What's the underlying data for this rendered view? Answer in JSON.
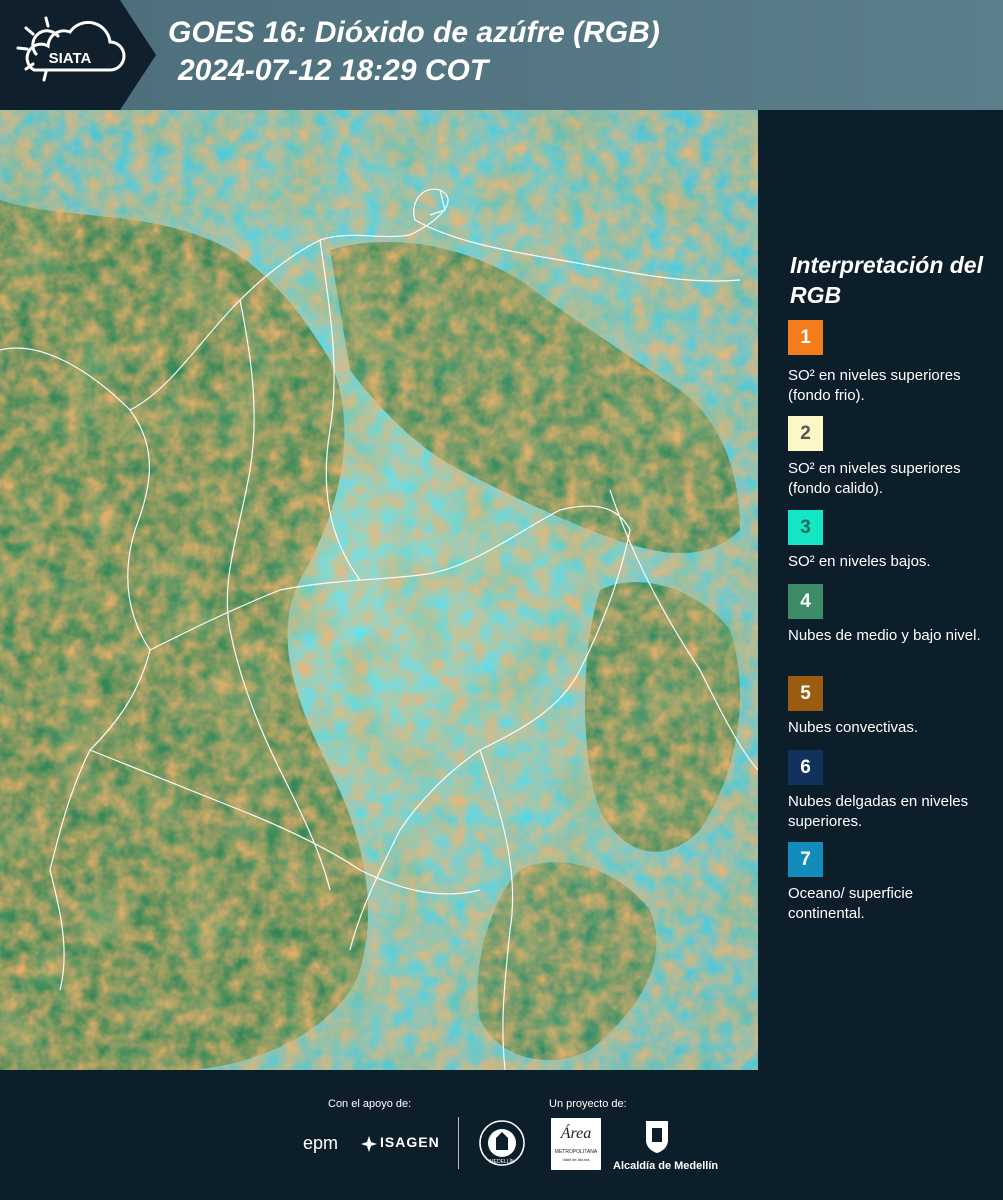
{
  "header": {
    "brand": "SIATA",
    "title_line1": "GOES 16: Dióxido de azúfre (RGB)",
    "title_line2": "2024-07-12 18:29 COT"
  },
  "legend": {
    "title": "Interpretación del RGB",
    "items": [
      {
        "num": "1",
        "color": "#f47c1a",
        "text_color": "#ffffff",
        "label": "SO² en niveles superiores (fondo frio)."
      },
      {
        "num": "2",
        "color": "#fdf6c6",
        "text_color": "#555555",
        "label": "SO² en niveles superiores (fondo calido)."
      },
      {
        "num": "3",
        "color": "#14e6c6",
        "text_color": "#1a6b60",
        "label": "SO² en niveles bajos."
      },
      {
        "num": "4",
        "color": "#3c8c68",
        "text_color": "#ffffff",
        "label": "Nubes de medio y bajo nivel."
      },
      {
        "num": "5",
        "color": "#9c5c10",
        "text_color": "#ffffff",
        "label": "Nubes convectivas."
      },
      {
        "num": "6",
        "color": "#12325e",
        "text_color": "#ffffff",
        "label": "Nubes delgadas en niveles superiores."
      },
      {
        "num": "7",
        "color": "#138cbc",
        "text_color": "#ffffff",
        "label": "Oceano/ superficie continental."
      }
    ]
  },
  "footer": {
    "support_label": "Con el apoyo de:",
    "project_label": "Un proyecto de:",
    "sponsor1": "epm",
    "sponsor2": "ISAGEN",
    "partner1": "MEDELLÍN",
    "partner2": "METROPOLITANA",
    "partner2_script": "Área",
    "partner2_sub": "Valle de Aburrá",
    "partner3": "Alcaldía de Medellín"
  }
}
